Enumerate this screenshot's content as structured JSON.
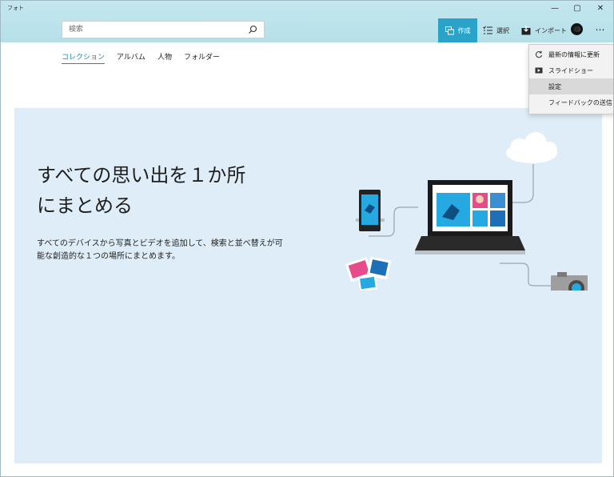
{
  "window": {
    "title": "フォト",
    "minimize_glyph": "—",
    "maximize_glyph": "▢",
    "close_glyph": "✕"
  },
  "search": {
    "placeholder": "検索",
    "icon": "search-icon"
  },
  "toolbar": {
    "create_label": "作成",
    "select_label": "選択",
    "import_label": "インポート",
    "more_label": "…",
    "accent_color": "#2ba3c8"
  },
  "tabs": [
    {
      "label": "コレクション",
      "active": true
    },
    {
      "label": "アルバム",
      "active": false
    },
    {
      "label": "人物",
      "active": false
    },
    {
      "label": "フォルダー",
      "active": false
    }
  ],
  "hero": {
    "title_line1": "すべての思い出を１か所",
    "title_line2": "にまとめる",
    "description_line1": "すべてのデバイスから写真とビデオを追加して、検索と並べ替えが可",
    "description_line2": "能な創造的な１つの場所にまとめます。",
    "background_color": "#deedf7"
  },
  "menu": {
    "items": [
      {
        "label": "最新の情報に更新",
        "icon": "refresh-icon"
      },
      {
        "label": "スライドショー",
        "icon": "slideshow-icon"
      },
      {
        "label": "設定",
        "icon": "",
        "hover": true
      },
      {
        "label": "フィードバックの送信",
        "icon": ""
      }
    ]
  }
}
